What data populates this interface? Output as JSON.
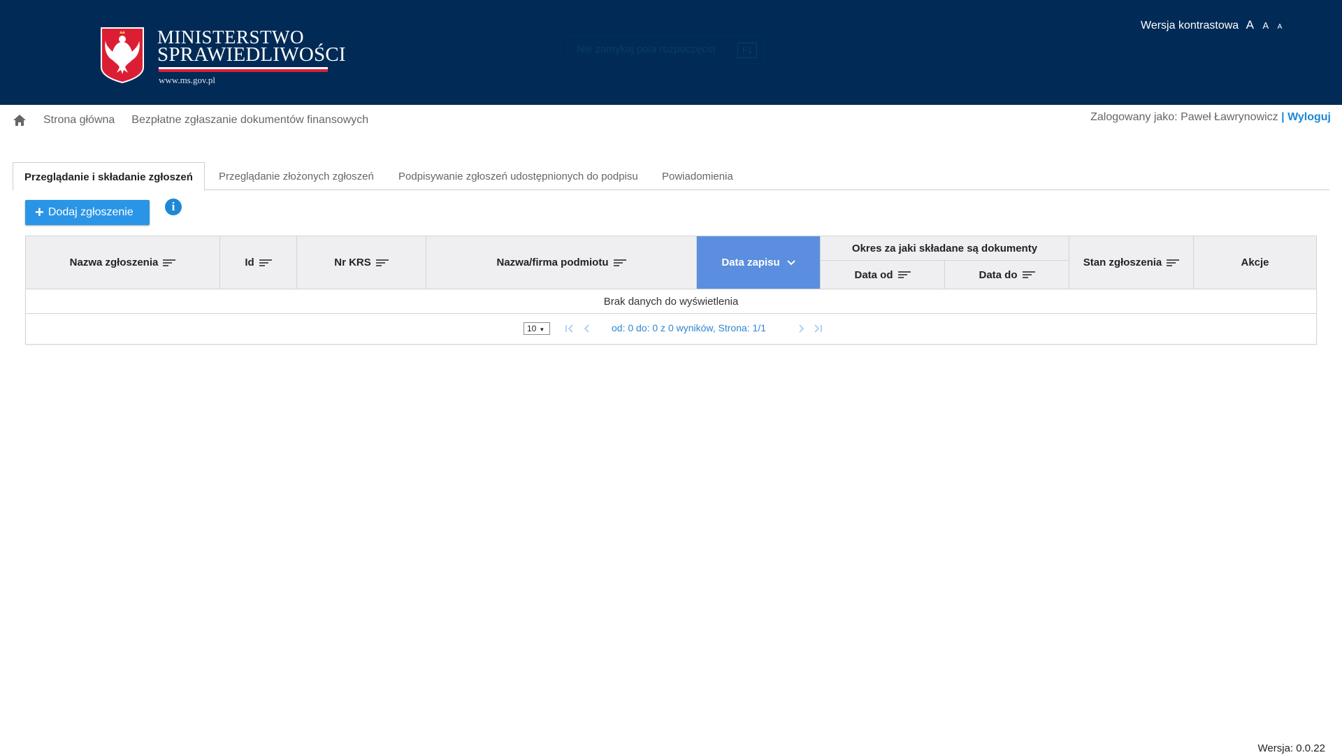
{
  "header": {
    "logo_line1": "MINISTERSTWO",
    "logo_line2": "SPRAWIEDLIWOŚCI",
    "logo_url": "www.ms.gov.pl",
    "faint_search_text": "Nie zamykaj pola rozpoczęcia",
    "faint_search_key": "F1",
    "contrast_label": "Wersja kontrastowa",
    "font_large": "A",
    "font_medium": "A",
    "font_small": "A",
    "bg_color": "#012b56"
  },
  "breadcrumb": {
    "home_icon": "home-icon",
    "items": [
      "Strona główna",
      "Bezpłatne zgłaszanie dokumentów finansowych"
    ]
  },
  "user": {
    "logged_as_label": "Zalogowany jako: Paweł Ławrynowicz",
    "separator": "|",
    "logout_label": "Wyloguj"
  },
  "tabs": [
    {
      "label": "Przeglądanie i składanie zgłoszeń",
      "active": true
    },
    {
      "label": "Przeglądanie złożonych zgłoszeń",
      "active": false
    },
    {
      "label": "Podpisywanie zgłoszeń udostępnionych do podpisu",
      "active": false
    },
    {
      "label": "Powiadomienia",
      "active": false
    }
  ],
  "actions": {
    "add_label": "Dodaj zgłoszenie",
    "add_icon": "plus-icon",
    "info_icon": "info-icon",
    "info_glyph": "i",
    "accent_color": "#2a95e6"
  },
  "table": {
    "columns": {
      "name": "Nazwa zgłoszenia",
      "id": "Id",
      "krs": "Nr KRS",
      "entity": "Nazwa/firma podmiotu",
      "saved": "Data zapisu",
      "period_group": "Okres za jaki składane są dokumenty",
      "date_from": "Data od",
      "date_to": "Data do",
      "status": "Stan zgłoszenia",
      "actions": "Akcje"
    },
    "sorted_column": "Data zapisu",
    "sorted_color": "#5b8ede",
    "empty_message": "Brak danych do wyświetlenia"
  },
  "paginator": {
    "rows_per_page": "10",
    "report": "od: 0 do: 0 z 0 wyników, Strona: 1/1"
  },
  "footer": {
    "version": "Wersja: 0.0.22"
  }
}
